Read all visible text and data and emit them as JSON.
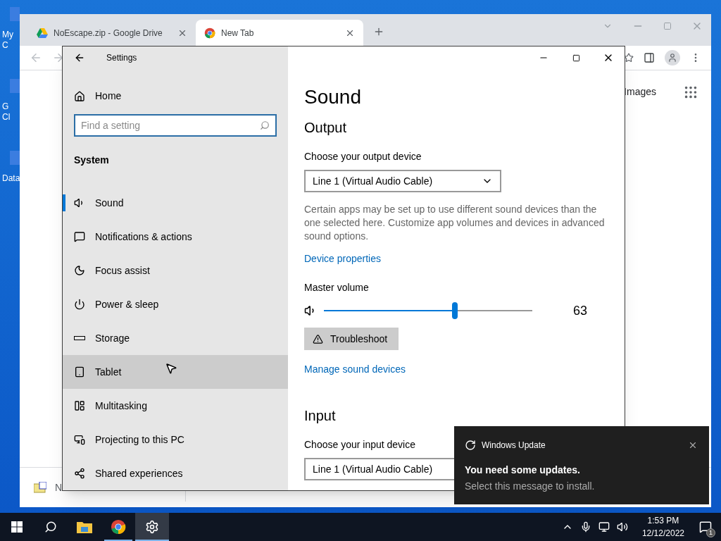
{
  "desktop": {
    "icons": [
      {
        "lines": [
          "My C"
        ]
      },
      {
        "lines": [
          "G",
          "Cl"
        ]
      },
      {
        "lines": [
          "Data"
        ]
      }
    ]
  },
  "browser": {
    "tabs": [
      {
        "title": "NoEscape.zip - Google Drive",
        "selected": false
      },
      {
        "title": "New Tab",
        "selected": true
      }
    ],
    "content_link": "Images",
    "download": {
      "name": "N"
    }
  },
  "settings": {
    "title": "Settings",
    "home": "Home",
    "search": {
      "placeholder": "Find a setting"
    },
    "section": "System",
    "nav": [
      {
        "label": "Sound",
        "selected": true,
        "hovered": false
      },
      {
        "label": "Notifications & actions",
        "selected": false,
        "hovered": false
      },
      {
        "label": "Focus assist",
        "selected": false,
        "hovered": false
      },
      {
        "label": "Power & sleep",
        "selected": false,
        "hovered": false
      },
      {
        "label": "Storage",
        "selected": false,
        "hovered": false
      },
      {
        "label": "Tablet",
        "selected": false,
        "hovered": true
      },
      {
        "label": "Multitasking",
        "selected": false,
        "hovered": false
      },
      {
        "label": "Projecting to this PC",
        "selected": false,
        "hovered": false
      },
      {
        "label": "Shared experiences",
        "selected": false,
        "hovered": false
      }
    ],
    "page_title": "Sound",
    "output": {
      "heading": "Output",
      "device_label": "Choose your output device",
      "device": "Line 1 (Virtual Audio Cable)",
      "note": "Certain apps may be set up to use different sound devices than the one selected here. Customize app volumes and devices in advanced sound options.",
      "link": "Device properties",
      "volume_label": "Master volume",
      "volume": {
        "level": 0.63,
        "reading": "63"
      },
      "troubleshoot": "Troubleshoot",
      "manage_link": "Manage sound devices"
    },
    "input": {
      "heading": "Input",
      "device_label": "Choose your input device",
      "device": "Line 1 (Virtual Audio Cable)"
    }
  },
  "toast": {
    "app": "Windows Update",
    "title": "You need some updates.",
    "body": "Select this message to install."
  },
  "taskbar": {
    "apps": [
      {
        "selected": false
      },
      {
        "selected": false
      },
      {
        "selected": true
      }
    ],
    "time": "1:53 PM",
    "date": "12/12/2022",
    "notifications": "1"
  }
}
